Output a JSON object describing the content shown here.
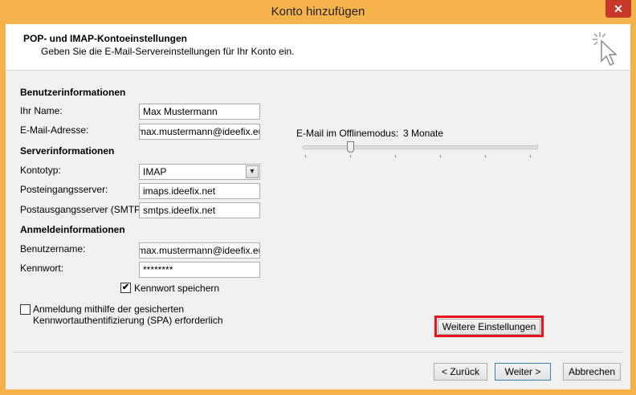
{
  "window": {
    "title": "Konto hinzufügen",
    "close_glyph": "✕"
  },
  "header": {
    "title": "POP- und IMAP-Kontoeinstellungen",
    "subtitle": "Geben Sie die E-Mail-Servereinstellungen für Ihr Konto ein."
  },
  "user_info": {
    "heading": "Benutzerinformationen",
    "name_label": "Ihr Name:",
    "name_value": "Max Mustermann",
    "email_label": "E-Mail-Adresse:",
    "email_value": "max.mustermann@ideefix.eu"
  },
  "server_info": {
    "heading": "Serverinformationen",
    "type_label": "Kontotyp:",
    "type_value": "IMAP",
    "incoming_label": "Posteingangsserver:",
    "incoming_value": "imaps.ideefix.net",
    "outgoing_label": "Postausgangsserver (SMTP):",
    "outgoing_value": "smtps.ideefix.net"
  },
  "login_info": {
    "heading": "Anmeldeinformationen",
    "username_label": "Benutzername:",
    "username_value": "max.mustermann@ideefix.eu",
    "password_label": "Kennwort:",
    "password_value": "********",
    "remember_label": "Kennwort speichern",
    "remember_checked": true,
    "spa_label_line1": "Anmeldung mithilfe der gesicherten",
    "spa_label_line2": "Kennwortauthentifizierung (SPA) erforderlich",
    "spa_checked": false
  },
  "offline": {
    "label": "E-Mail im Offlinemodus:",
    "value": "3 Monate",
    "slider_position": 0.2
  },
  "buttons": {
    "more_settings": "Weitere Einstellungen",
    "back": "< Zurück",
    "next": "Weiter >",
    "cancel": "Abbrechen"
  },
  "icons": {
    "checkmark": "✔",
    "dropdown": "▼",
    "wizard": "wizard-cursor-icon"
  },
  "colors": {
    "frame": "#f6b24b",
    "highlight": "#e8141c",
    "close": "#c7382b"
  }
}
